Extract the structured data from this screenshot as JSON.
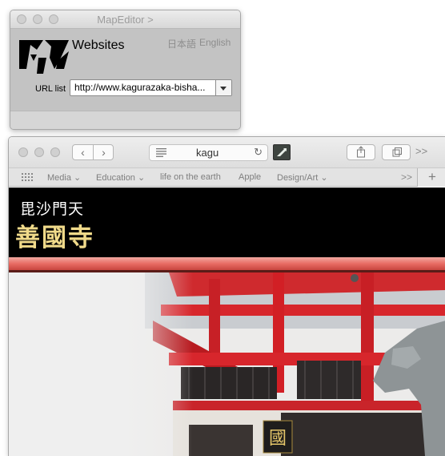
{
  "map_editor": {
    "title": "MapEditor >",
    "heading": "Websites",
    "lang_ja": "日本語",
    "lang_en": "English",
    "url_label": "URL list",
    "url_value": "http://www.kagurazaka-bisha..."
  },
  "safari": {
    "address_text": "kagu",
    "favorites": [
      "Media ⌄",
      "Education ⌄",
      "life on the earth",
      "Apple",
      "Design/Art ⌄"
    ],
    "more": ">>",
    "new_tab": "+"
  },
  "page": {
    "header_small": "毘沙門天",
    "header_big": "善國寺",
    "sign_text": "國"
  },
  "colors": {
    "header_bg": "#000000",
    "header_gold": "#f0da8a",
    "temple_red": "#d7262c",
    "pink_band": "#e86c64"
  }
}
